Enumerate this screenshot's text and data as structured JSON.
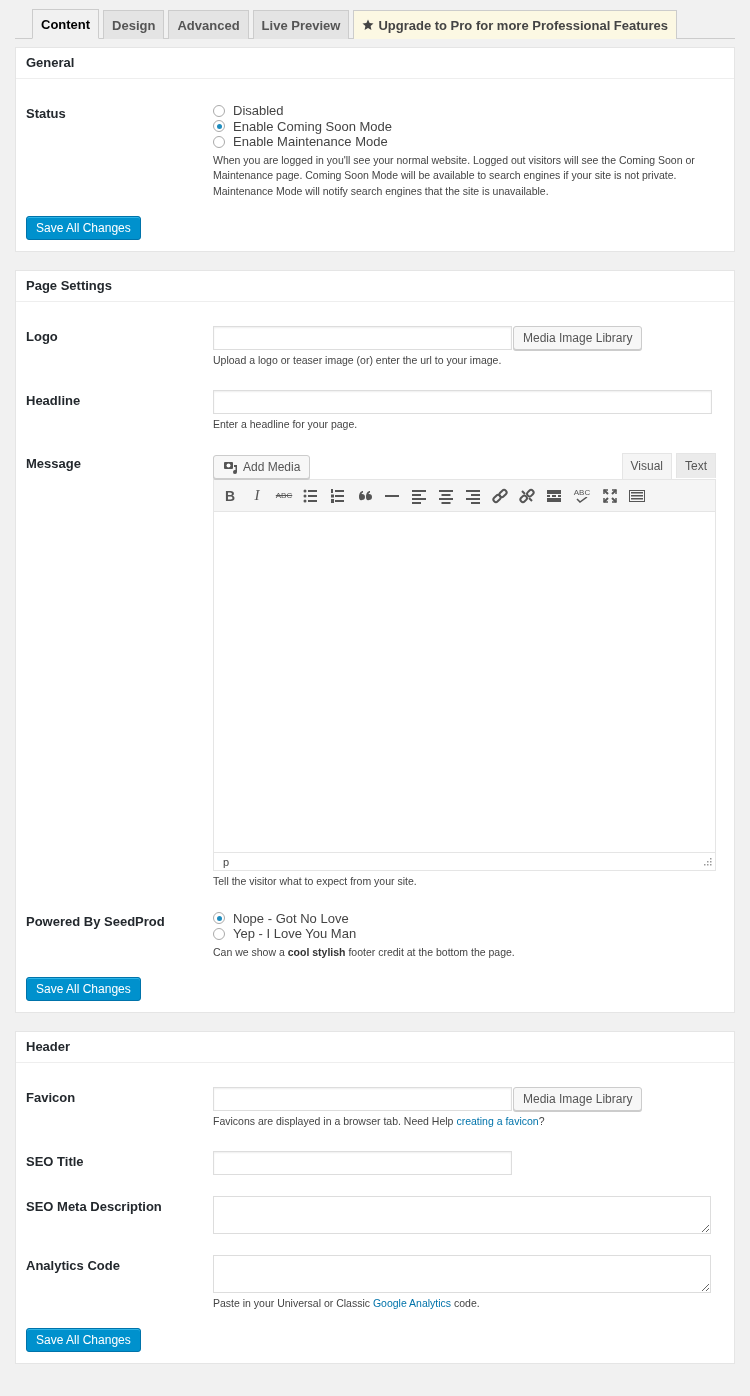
{
  "tabs": [
    {
      "label": "Content",
      "selected": true,
      "kind": "plain"
    },
    {
      "label": "Design",
      "selected": false,
      "kind": "plain"
    },
    {
      "label": "Advanced",
      "selected": false,
      "kind": "plain"
    },
    {
      "label": "Live Preview",
      "selected": false,
      "kind": "plain"
    },
    {
      "label": "Upgrade to Pro for more Professional Features",
      "selected": false,
      "kind": "upgrade"
    }
  ],
  "sections": [
    {
      "title": "General",
      "button": "Save All Changes",
      "fields": [
        {
          "kind": "radio",
          "label": "Status",
          "options": [
            {
              "label": "Disabled",
              "selected": false
            },
            {
              "label": "Enable Coming Soon Mode",
              "selected": true
            },
            {
              "label": "Enable Maintenance Mode",
              "selected": false
            }
          ],
          "description": [
            {
              "kind": "text",
              "text": "When you are logged in you'll see your normal website. Logged out visitors will see the Coming Soon or Maintenance page. Coming Soon Mode will be available to search engines if your site is not private. Maintenance Mode will notify search engines that the site is unavailable."
            }
          ]
        }
      ]
    },
    {
      "title": "Page Settings",
      "button": "Save All Changes",
      "fields": [
        {
          "kind": "upload",
          "label": "Logo",
          "button": "Media Image Library",
          "description": [
            {
              "kind": "text",
              "text": "Upload a logo or teaser image (or) enter the url to your image."
            }
          ]
        },
        {
          "kind": "text",
          "label": "Headline",
          "wide": true,
          "description": [
            {
              "kind": "text",
              "text": "Enter a headline for your page."
            }
          ]
        },
        {
          "kind": "editor",
          "label": "Message",
          "add_media": "Add Media",
          "editor_tabs": [
            {
              "label": "Visual",
              "selected": true
            },
            {
              "label": "Text",
              "selected": false
            }
          ],
          "toolbar": [
            {
              "kind": "bold",
              "label": "B"
            },
            {
              "kind": "italic",
              "label": "I"
            },
            {
              "kind": "strikethrough",
              "label": "ABC"
            },
            {
              "kind": "bullet-list"
            },
            {
              "kind": "number-list"
            },
            {
              "kind": "quote"
            },
            {
              "kind": "rule"
            },
            {
              "kind": "align-left"
            },
            {
              "kind": "align-center"
            },
            {
              "kind": "align-right"
            },
            {
              "kind": "link"
            },
            {
              "kind": "unlink"
            },
            {
              "kind": "more"
            },
            {
              "kind": "spellcheck",
              "label": "ABC"
            },
            {
              "kind": "fullscreen"
            },
            {
              "kind": "keyboard"
            }
          ],
          "path": "p",
          "description": [
            {
              "kind": "text",
              "text": "Tell the visitor what to expect from your site."
            }
          ]
        },
        {
          "kind": "radio",
          "label": "Powered By SeedProd",
          "options": [
            {
              "label": "Nope - Got No Love",
              "selected": true
            },
            {
              "label": "Yep - I Love You Man",
              "selected": false
            }
          ],
          "description": [
            {
              "kind": "text",
              "text": "Can we show a **cool stylish** footer credit at the bottom the page."
            }
          ]
        }
      ]
    },
    {
      "title": "Header",
      "button": "Save All Changes",
      "fields": [
        {
          "kind": "upload",
          "label": "Favicon",
          "button": "Media Image Library",
          "description": [
            {
              "kind": "text",
              "text": "Favicons are displayed in a browser tab. Need Help "
            },
            {
              "kind": "link",
              "text": "creating a favicon"
            },
            {
              "kind": "text",
              "text": "?"
            }
          ]
        },
        {
          "kind": "text",
          "label": "SEO Title",
          "wide": false
        },
        {
          "kind": "textarea",
          "label": "SEO Meta Description"
        },
        {
          "kind": "textarea",
          "label": "Analytics Code",
          "description": [
            {
              "kind": "text",
              "text": "Paste in your Universal or Classic "
            },
            {
              "kind": "link",
              "text": "Google Analytics"
            },
            {
              "kind": "text",
              "text": " code."
            }
          ]
        }
      ]
    }
  ]
}
